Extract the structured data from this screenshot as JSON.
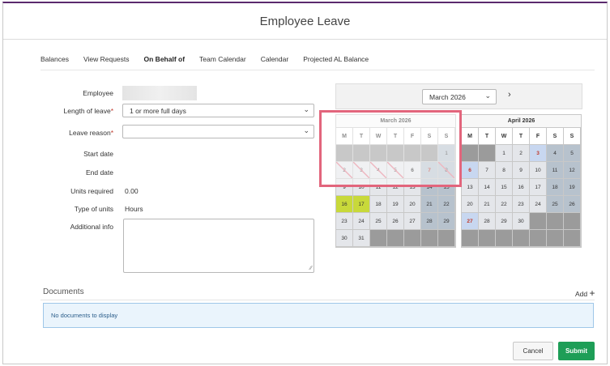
{
  "window": {
    "title": "Employee Leave"
  },
  "tabs": [
    {
      "label": "Balances"
    },
    {
      "label": "View Requests"
    },
    {
      "label": "On Behalf of"
    },
    {
      "label": "Team Calendar"
    },
    {
      "label": "Calendar"
    },
    {
      "label": "Projected AL Balance"
    }
  ],
  "form": {
    "employee_label": "Employee",
    "length_label": "Length of leave",
    "length_value": "1 or more full days",
    "reason_label": "Leave reason",
    "reason_value": "",
    "required_mark": "*",
    "start_label": "Start date",
    "end_label": "End date",
    "units_label": "Units required",
    "units_value": "0.00",
    "type_label": "Type of units",
    "type_value": "Hours",
    "info_label": "Additional info"
  },
  "calendar": {
    "selected_month": "March 2026",
    "weekdays": [
      "M",
      "T",
      "W",
      "T",
      "F",
      "S",
      "S"
    ],
    "months": [
      {
        "name": "March 2026",
        "cells": [
          {
            "d": "",
            "t": "e"
          },
          {
            "d": "",
            "t": "e"
          },
          {
            "d": "",
            "t": "e"
          },
          {
            "d": "",
            "t": "e"
          },
          {
            "d": "",
            "t": "e"
          },
          {
            "d": "",
            "t": "e"
          },
          {
            "d": "1",
            "t": "w"
          },
          {
            "d": "2",
            "t": "n slash"
          },
          {
            "d": "3",
            "t": "n slash"
          },
          {
            "d": "4",
            "t": "n slash"
          },
          {
            "d": "5",
            "t": "n slash"
          },
          {
            "d": "6",
            "t": "n bk"
          },
          {
            "d": "7",
            "t": "w sel"
          },
          {
            "d": "8",
            "t": "w slash"
          },
          {
            "d": "9",
            "t": "n"
          },
          {
            "d": "10",
            "t": "n"
          },
          {
            "d": "11",
            "t": "n"
          },
          {
            "d": "12",
            "t": "n"
          },
          {
            "d": "13",
            "t": "n"
          },
          {
            "d": "14",
            "t": "w"
          },
          {
            "d": "15",
            "t": "w"
          },
          {
            "d": "16",
            "t": "g"
          },
          {
            "d": "17",
            "t": "g"
          },
          {
            "d": "18",
            "t": "n"
          },
          {
            "d": "19",
            "t": "n"
          },
          {
            "d": "20",
            "t": "n"
          },
          {
            "d": "21",
            "t": "w"
          },
          {
            "d": "22",
            "t": "w"
          },
          {
            "d": "23",
            "t": "n"
          },
          {
            "d": "24",
            "t": "n"
          },
          {
            "d": "25",
            "t": "n"
          },
          {
            "d": "26",
            "t": "n"
          },
          {
            "d": "27",
            "t": "n"
          },
          {
            "d": "28",
            "t": "w"
          },
          {
            "d": "29",
            "t": "w"
          },
          {
            "d": "30",
            "t": "n"
          },
          {
            "d": "31",
            "t": "n"
          },
          {
            "d": "",
            "t": "e"
          },
          {
            "d": "",
            "t": "e"
          },
          {
            "d": "",
            "t": "e"
          },
          {
            "d": "",
            "t": "e"
          },
          {
            "d": "",
            "t": "e"
          }
        ]
      },
      {
        "name": "April 2026",
        "cells": [
          {
            "d": "",
            "t": "e"
          },
          {
            "d": "",
            "t": "e"
          },
          {
            "d": "1",
            "t": "n"
          },
          {
            "d": "2",
            "t": "n"
          },
          {
            "d": "3",
            "t": "hl"
          },
          {
            "d": "4",
            "t": "w"
          },
          {
            "d": "5",
            "t": "w"
          },
          {
            "d": "6",
            "t": "hl"
          },
          {
            "d": "7",
            "t": "n"
          },
          {
            "d": "8",
            "t": "n"
          },
          {
            "d": "9",
            "t": "n"
          },
          {
            "d": "10",
            "t": "n"
          },
          {
            "d": "11",
            "t": "w"
          },
          {
            "d": "12",
            "t": "w"
          },
          {
            "d": "13",
            "t": "n"
          },
          {
            "d": "14",
            "t": "n"
          },
          {
            "d": "15",
            "t": "n"
          },
          {
            "d": "16",
            "t": "n"
          },
          {
            "d": "17",
            "t": "n"
          },
          {
            "d": "18",
            "t": "w"
          },
          {
            "d": "19",
            "t": "w"
          },
          {
            "d": "20",
            "t": "n"
          },
          {
            "d": "21",
            "t": "n"
          },
          {
            "d": "22",
            "t": "n"
          },
          {
            "d": "23",
            "t": "n"
          },
          {
            "d": "24",
            "t": "n"
          },
          {
            "d": "25",
            "t": "w"
          },
          {
            "d": "26",
            "t": "w"
          },
          {
            "d": "27",
            "t": "hl"
          },
          {
            "d": "28",
            "t": "n"
          },
          {
            "d": "29",
            "t": "n"
          },
          {
            "d": "30",
            "t": "n"
          },
          {
            "d": "",
            "t": "e"
          },
          {
            "d": "",
            "t": "e"
          },
          {
            "d": "",
            "t": "e"
          },
          {
            "d": "",
            "t": "e"
          },
          {
            "d": "",
            "t": "e"
          },
          {
            "d": "",
            "t": "e"
          },
          {
            "d": "",
            "t": "e"
          },
          {
            "d": "",
            "t": "e"
          },
          {
            "d": "",
            "t": "e"
          },
          {
            "d": "",
            "t": "e"
          }
        ]
      }
    ]
  },
  "documents": {
    "title": "Documents",
    "add_label": "Add",
    "empty_text": "No documents to display"
  },
  "actions": {
    "cancel_label": "Cancel",
    "submit_label": "Submit"
  },
  "colors": {
    "accent": "#5b2a6e",
    "submit": "#1e9e57",
    "highlight_border": "#e2657c"
  }
}
